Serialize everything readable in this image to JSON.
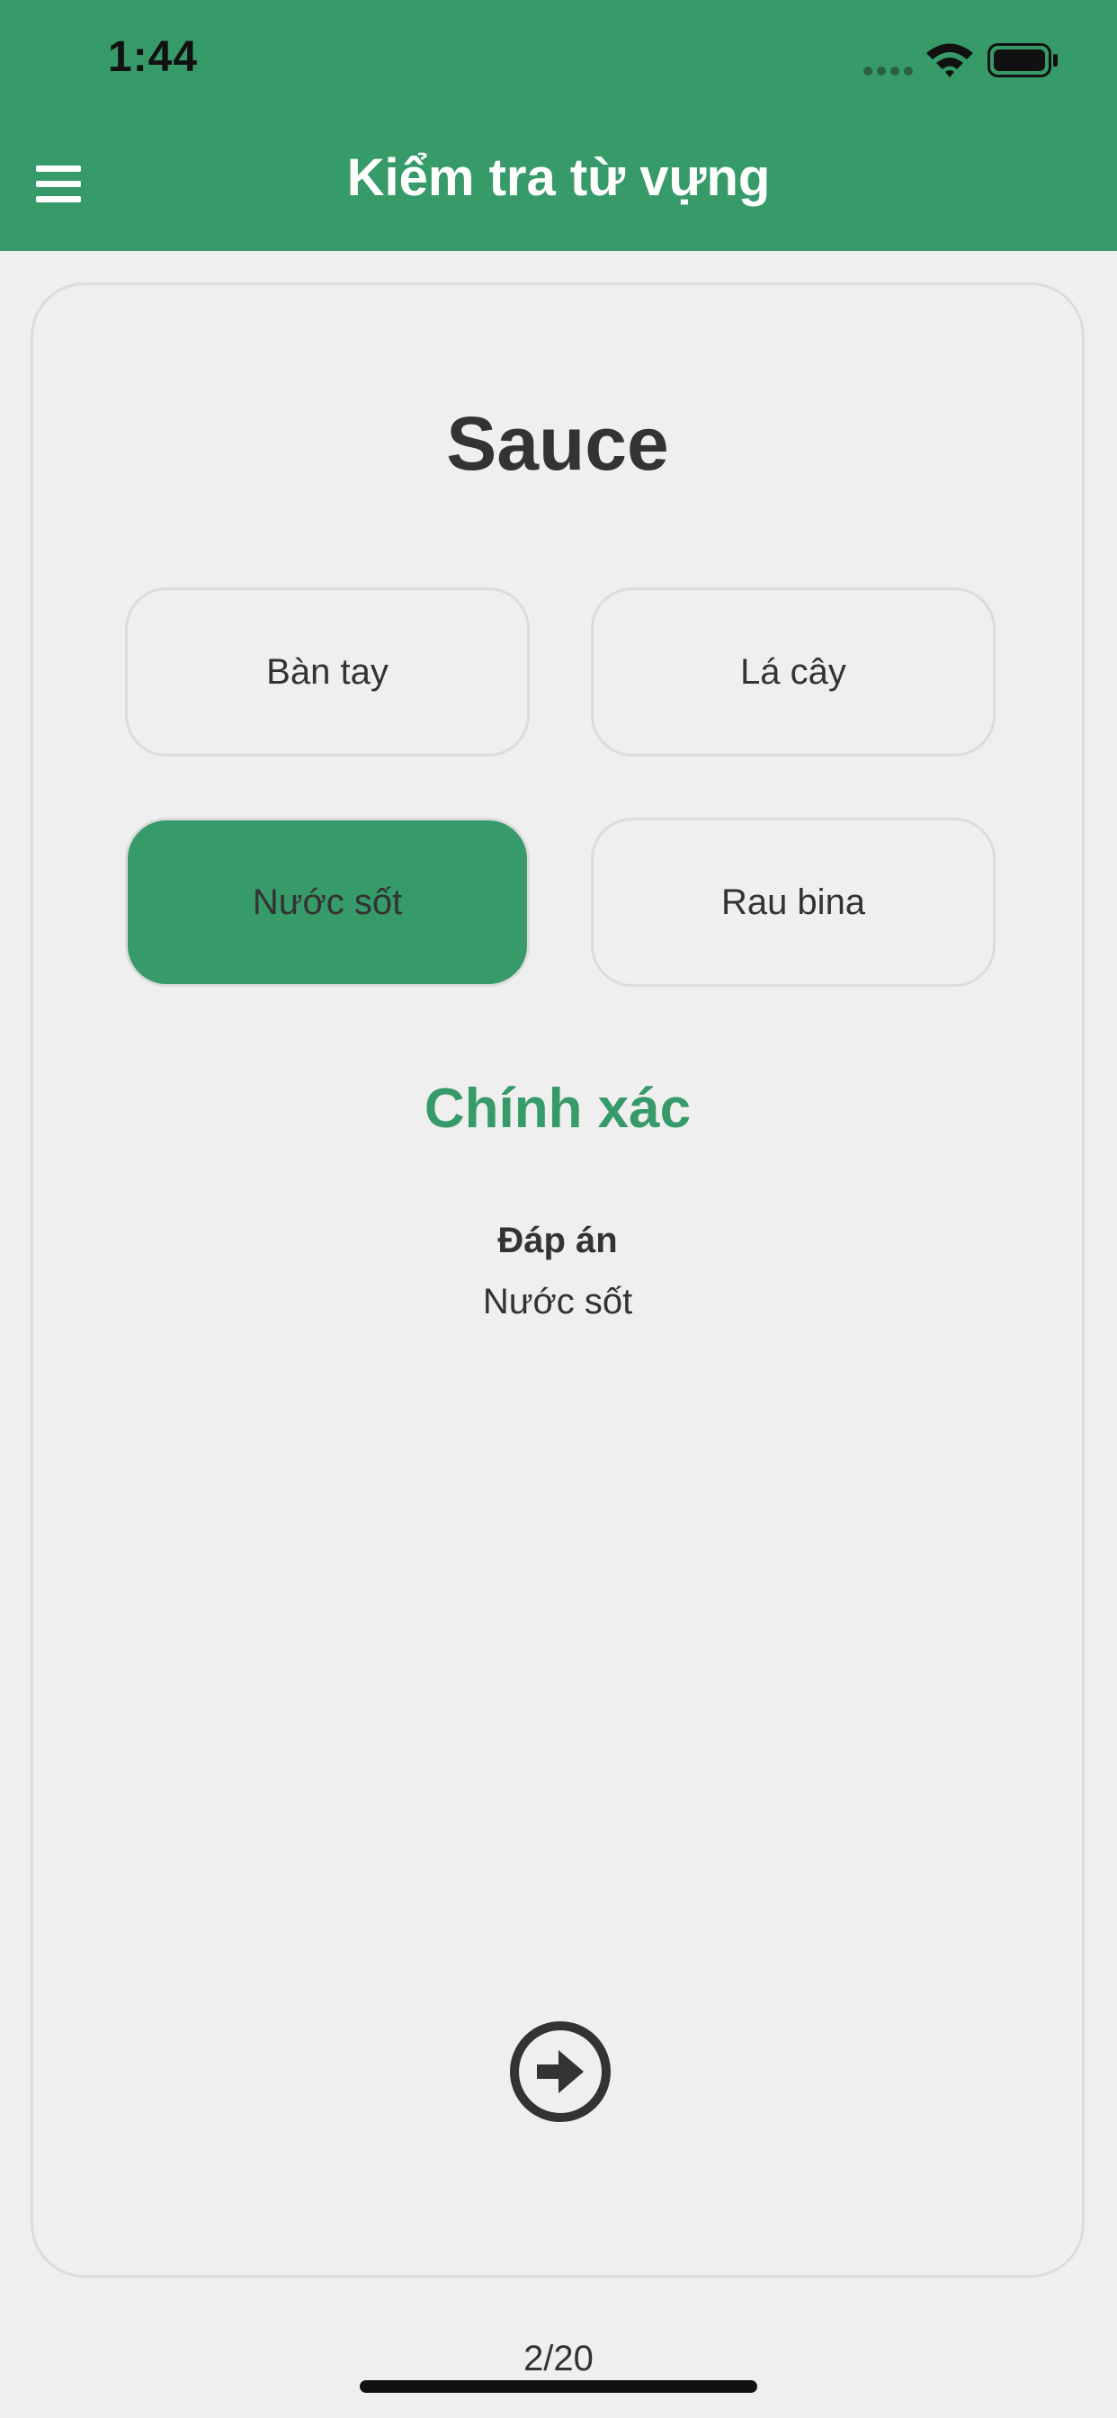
{
  "status_bar": {
    "time": "1:44"
  },
  "nav": {
    "title": "Kiểm tra từ vựng",
    "menu_icon": "hamburger-menu-icon"
  },
  "quiz": {
    "word": "Sauce",
    "options": [
      {
        "label": "Bàn tay",
        "selected": false
      },
      {
        "label": "Lá cây",
        "selected": false
      },
      {
        "label": "Nước sốt",
        "selected": true
      },
      {
        "label": "Rau bina",
        "selected": false
      }
    ],
    "result": "Chính xác",
    "answer_label": "Đáp án",
    "answer_value": "Nước sốt",
    "next_icon": "arrow-right-circle-icon"
  },
  "progress": "2/20",
  "colors": {
    "primary": "#369b69",
    "background": "#efefef",
    "text": "#333333",
    "border": "#dcdcdc"
  }
}
